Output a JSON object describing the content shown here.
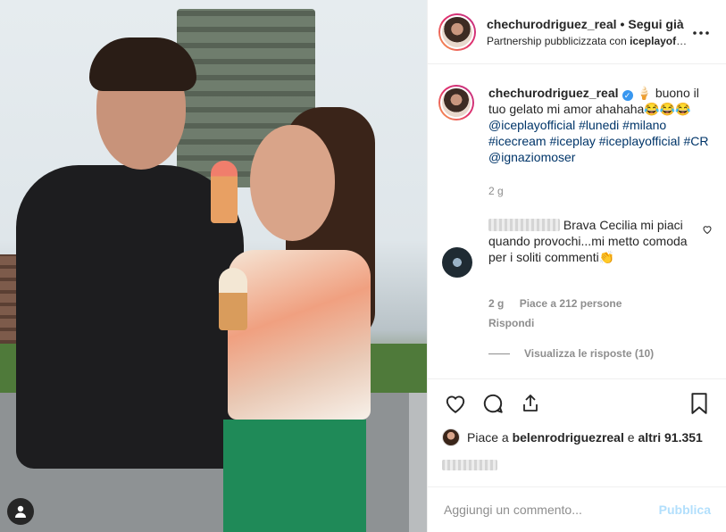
{
  "post": {
    "username": "chechurodriguez_real",
    "follow_label": "Segui già",
    "partnership_prefix": "Partnership pubblicizzata con ",
    "partner": "iceplayofficial",
    "more_label": "•••"
  },
  "caption": {
    "username": "chechurodriguez_real",
    "text_start": "🍦 buono il tuo gelato mi amor ahahaha😂😂😂",
    "tags": [
      "@iceplayofficial",
      "#lunedi",
      "#milano",
      "#icecream",
      "#iceplay",
      "#iceplayofficial",
      "#CR",
      "@ignaziomoser"
    ],
    "time": "2 g"
  },
  "comment": {
    "text": "Brava Cecilia mi piaci quando provochi...mi metto comoda per i soliti commenti👏",
    "time": "2 g",
    "likes": "Piace a 212 persone",
    "reply_label": "Rispondi",
    "view_replies": "Visualizza le risposte (10)"
  },
  "likes": {
    "prefix": "Piace a ",
    "user": "belenrodriguezreal",
    "connector": " e ",
    "others": "altri 91.351"
  },
  "add_comment": {
    "placeholder": "Aggiungi un commento...",
    "publish_label": "Pubblica"
  },
  "icons": {
    "like": "heart-icon",
    "comment": "comment-icon",
    "share": "share-icon",
    "save": "bookmark-icon",
    "more": "more-icon",
    "user": "user-icon"
  },
  "colors": {
    "link": "#003569",
    "muted": "#8e8e8e",
    "verified": "#3897f0",
    "publish_disabled": "#b2dffc"
  }
}
